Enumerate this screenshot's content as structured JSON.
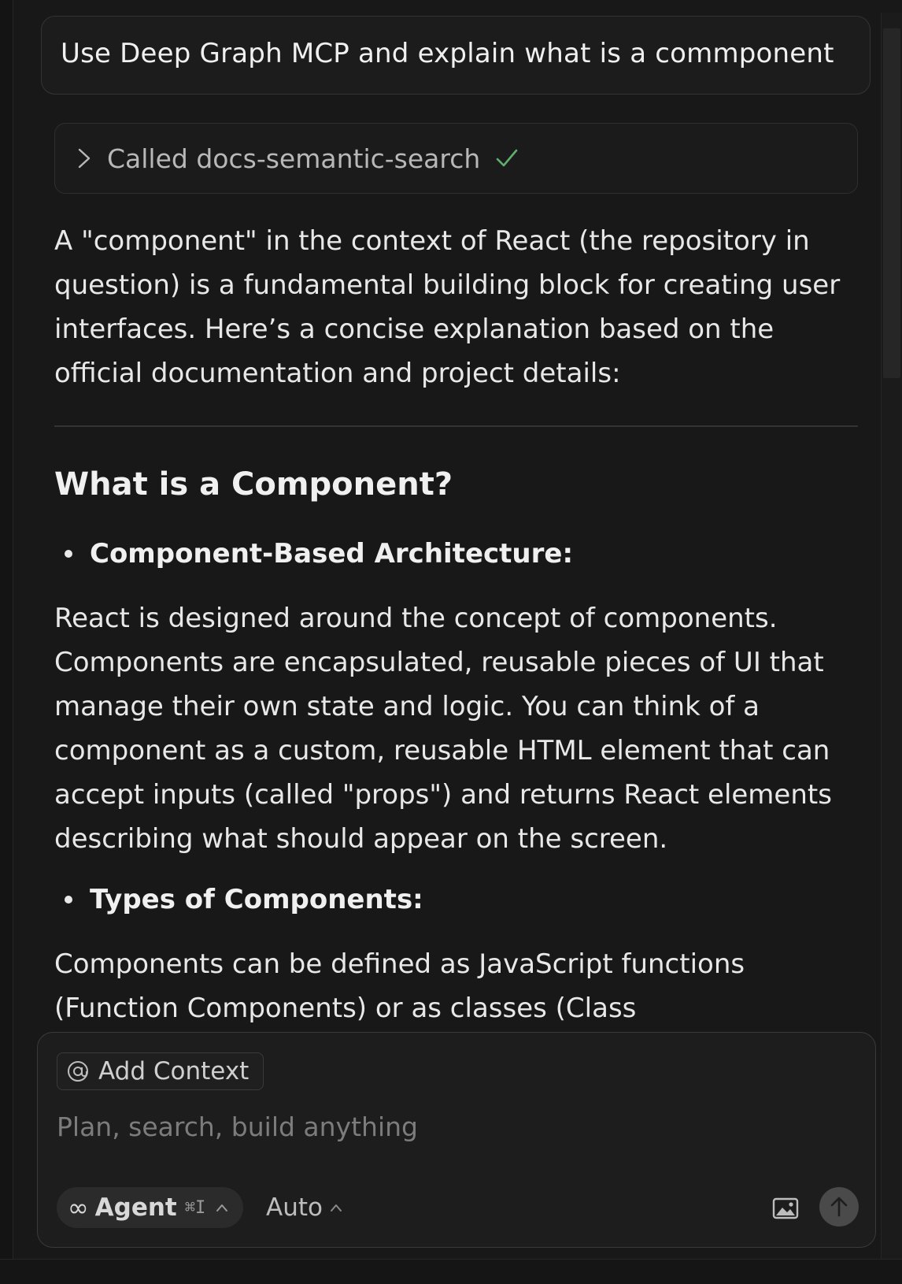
{
  "user_message": "Use Deep Graph MCP and explain what is a commponent",
  "tool_call": {
    "label": "Called docs-semantic-search",
    "status_icon": "check-icon",
    "expand_icon": "chevron-right-icon"
  },
  "response": {
    "intro": "A \"component\" in the context of React (the repository in question) is a fundamental building block for creating user interfaces. Here’s a concise explanation based on the official documentation and project details:",
    "heading": "What is a Component?",
    "sections": [
      {
        "bullet": "Component-Based Architecture:",
        "text": "React is designed around the concept of components. Components are encapsulated, reusable pieces of UI that manage their own state and logic. You can think of a component as a custom, reusable HTML element that can accept inputs (called \"props\") and returns React elements describing what should appear on the screen."
      },
      {
        "bullet": "Types of Components:",
        "text": "Components can be defined as JavaScript functions (Function Components) or as classes (Class"
      }
    ]
  },
  "composer": {
    "add_context_label": "Add Context",
    "placeholder": "Plan, search, build anything",
    "mode_label": "Agent",
    "mode_shortcut": "⌘I",
    "model_label": "Auto"
  },
  "colors": {
    "background": "#181818",
    "check": "#5fae6e",
    "send_button": "#4a4a4a"
  }
}
